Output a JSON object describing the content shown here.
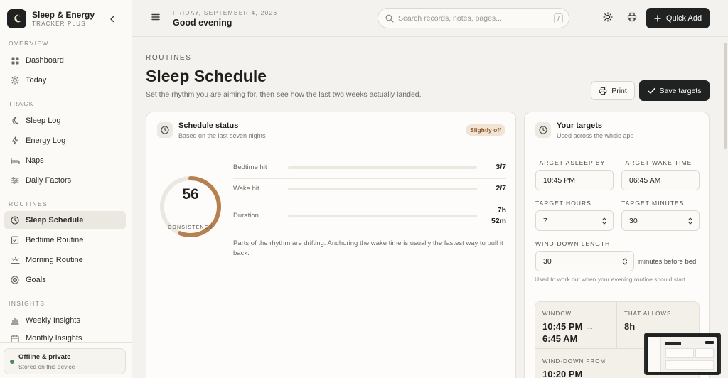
{
  "brand": {
    "title": "Sleep & Energy",
    "subtitle": "TRACKER PLUS"
  },
  "sidebar": {
    "sections": [
      {
        "label": "OVERVIEW"
      },
      {
        "label": "TRACK"
      },
      {
        "label": "ROUTINES"
      },
      {
        "label": "INSIGHTS"
      }
    ],
    "items": [
      {
        "label": "Dashboard",
        "icon": "grid-icon"
      },
      {
        "label": "Today",
        "icon": "sun-icon"
      },
      {
        "label": "Sleep Log",
        "icon": "moon-icon"
      },
      {
        "label": "Energy Log",
        "icon": "bolt-icon"
      },
      {
        "label": "Naps",
        "icon": "bed-icon"
      },
      {
        "label": "Daily Factors",
        "icon": "sliders-icon"
      },
      {
        "label": "Sleep Schedule",
        "icon": "clock-icon",
        "active": true
      },
      {
        "label": "Bedtime Routine",
        "icon": "checklist-icon"
      },
      {
        "label": "Morning Routine",
        "icon": "sunrise-icon"
      },
      {
        "label": "Goals",
        "icon": "target-icon"
      },
      {
        "label": "Weekly Insights",
        "icon": "chart-icon"
      },
      {
        "label": "Monthly Insights",
        "icon": "calendar-icon"
      }
    ],
    "offline": {
      "title": "Offline & private",
      "subtitle": "Stored on this device"
    }
  },
  "topbar": {
    "date": "FRIDAY, SEPTEMBER 4, 2026",
    "greeting": "Good evening",
    "search_placeholder": "Search records, notes, pages...",
    "search_shortcut": "/",
    "quick_add": "Quick Add"
  },
  "page": {
    "eyebrow": "ROUTINES",
    "title": "Sleep Schedule",
    "subtitle": "Set the rhythm you are aiming for, then see how the last two weeks actually landed.",
    "print": "Print",
    "save": "Save targets"
  },
  "status": {
    "title": "Schedule status",
    "subtitle": "Based on the last seven nights",
    "badge": "Slightly off",
    "score": "56",
    "score_value": 56,
    "score_label": "CONSISTENCY",
    "metrics": [
      {
        "label": "Bedtime hit",
        "value": "3/7",
        "fraction": 0
      },
      {
        "label": "Wake hit",
        "value": "2/7",
        "fraction": 0
      },
      {
        "label": "Duration",
        "value_line1": "7h",
        "value_line2": "52m",
        "fraction": 0
      }
    ],
    "note": "Parts of the rhythm are drifting. Anchoring the wake time is usually the fastest way to pull it back."
  },
  "targets": {
    "title": "Your targets",
    "subtitle": "Used across the whole app",
    "asleep_label": "TARGET ASLEEP BY",
    "asleep_value": "10:45 PM",
    "wake_label": "TARGET WAKE TIME",
    "wake_value": "06:45 AM",
    "hours_label": "TARGET HOURS",
    "hours_value": "7",
    "minutes_label": "TARGET MINUTES",
    "minutes_value": "30",
    "winddown_label": "WIND-DOWN LENGTH",
    "winddown_value": "30",
    "winddown_suffix": "minutes before bed",
    "helper": "Used to work out when your evening routine should start.",
    "window_label": "WINDOW",
    "window_value": "10:45 PM → 6:45 AM",
    "allows_label": "THAT ALLOWS",
    "allows_value": "8h",
    "winddown_from_label": "WIND-DOWN FROM",
    "winddown_from_value": "10:20 PM"
  },
  "colors": {
    "accent": "#b7814f",
    "dark": "#1f2220",
    "background": "#f4f2ee"
  }
}
